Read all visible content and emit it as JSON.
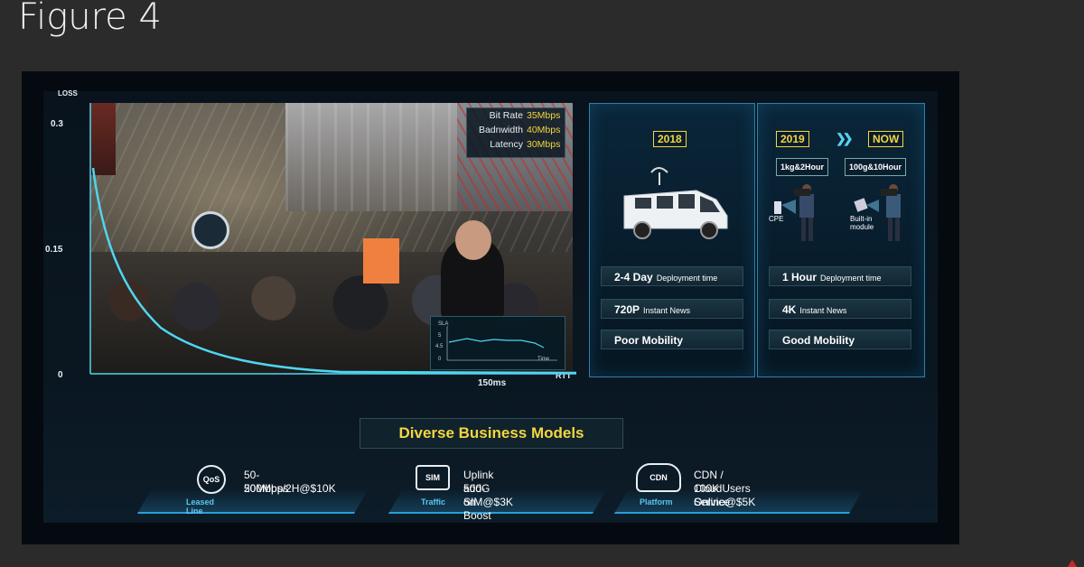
{
  "figure_title": "Figure 4",
  "chart": {
    "y_axis_label": "LOSS",
    "y_ticks": [
      "0.3",
      "0.15",
      "0"
    ],
    "x_axis_label": "RTT",
    "x_tick": "150ms"
  },
  "metrics_overlay": [
    {
      "label": "Bit Rate",
      "value": "35Mbps"
    },
    {
      "label": "Badnwidth",
      "value": "40Mbps"
    },
    {
      "label": "Latency",
      "value": "30Mbps"
    }
  ],
  "sla_overlay": {
    "title": "SLA",
    "ticks": [
      "5",
      "4.5",
      "0"
    ],
    "x_label": "Time"
  },
  "panel_2018": {
    "year": "2018",
    "rows": [
      {
        "main": "2-4 Day",
        "sub": "Deployment time"
      },
      {
        "main": "720P",
        "sub": "Instant News"
      },
      {
        "main": "Poor Mobility",
        "sub": ""
      }
    ]
  },
  "panel_now": {
    "year_from": "2019",
    "year_to": "NOW",
    "chevron": "❯❯",
    "tag_left": "1kg&2Hour",
    "tag_right": "100g&10Hour",
    "label_left": "CPE",
    "label_right_1": "Built-in",
    "label_right_2": "module",
    "rows": [
      {
        "main": "1 Hour",
        "sub": "Deployment time"
      },
      {
        "main": "4K",
        "sub": "Instant News"
      },
      {
        "main": "Good Mobility",
        "sub": ""
      }
    ]
  },
  "business": {
    "title": "Diverse Business Models",
    "items": [
      {
        "icon": "QoS",
        "caption": "Leased Line",
        "line1": "50-200Mbps",
        "line2": "50Mbps/2H@$10K"
      },
      {
        "icon": "SIM",
        "caption": "Traffic",
        "line1": "Uplink add-on Boost",
        "line2": "500G SIM@$3K"
      },
      {
        "icon": "CDN",
        "caption": "Platform",
        "line1": "CDN / Cloud Service",
        "line2": "100K Users Online@$5K"
      }
    ]
  },
  "colors": {
    "accent_yellow": "#f3d640",
    "accent_blue": "#2aa0d8",
    "curve": "#4fd6f0"
  }
}
